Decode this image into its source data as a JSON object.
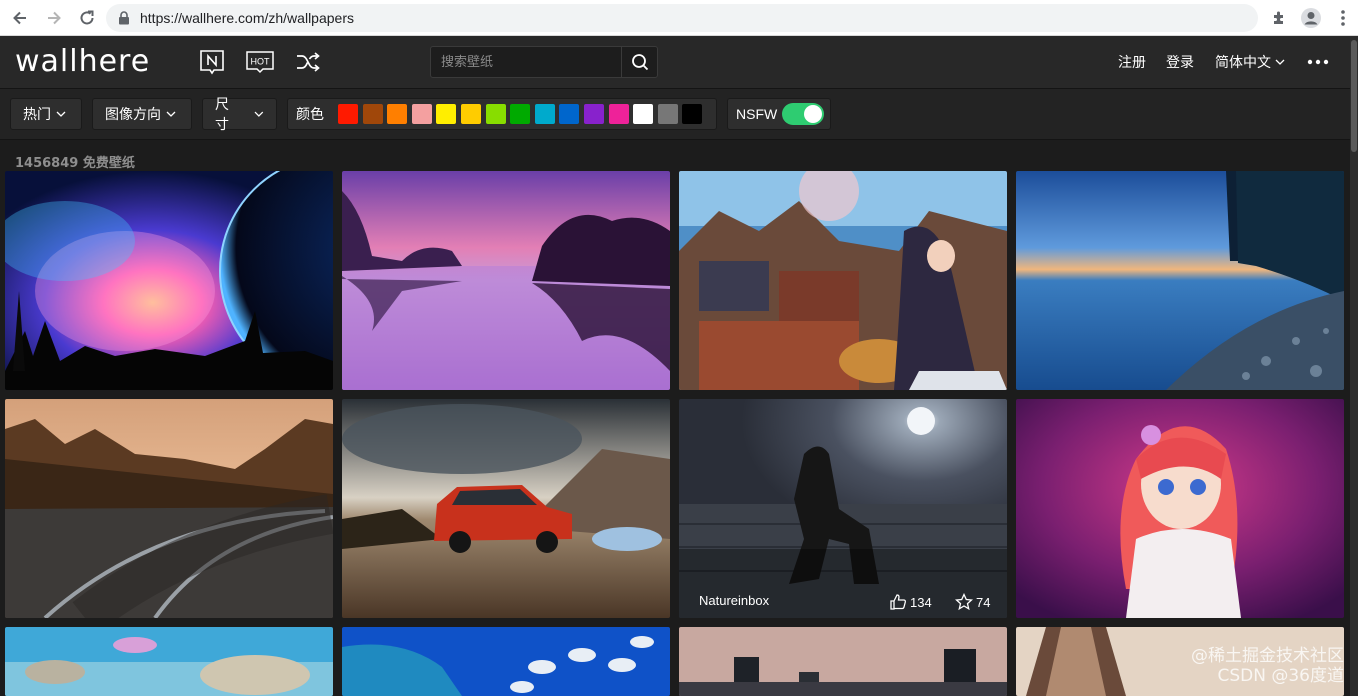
{
  "browser": {
    "url": "https://wallhere.com/zh/wallpapers",
    "icons": [
      "back-arrow-icon",
      "forward-arrow-icon",
      "reload-icon",
      "lock-icon",
      "extensions-icon",
      "profile-icon",
      "menu-dots-icon"
    ]
  },
  "header": {
    "logo": "wallhere",
    "search_placeholder": "搜索壁纸",
    "register": "注册",
    "login": "登录",
    "language": "简体中文",
    "icons": [
      "new-icon",
      "hot-icon",
      "shuffle-icon",
      "search-icon",
      "more-icon"
    ]
  },
  "filters": {
    "popular": "热门",
    "orientation": "图像方向",
    "size": "尺寸",
    "color_label": "颜色",
    "colors": [
      "#ff1a00",
      "#a0470a",
      "#ff7f00",
      "#f4a0a0",
      "#ffee00",
      "#ffcc00",
      "#88dd00",
      "#00aa00",
      "#00aacc",
      "#0066cc",
      "#8822cc",
      "#ee2299",
      "#ffffff",
      "#777777",
      "#000000"
    ],
    "nsfw_label": "NSFW",
    "nsfw_on": true
  },
  "count_text": "1456849 免费壁纸",
  "tiles": [
    {
      "name": "space-nebula-wallpaper"
    },
    {
      "name": "purple-lake-sunset-wallpaper"
    },
    {
      "name": "anime-town-wallpaper"
    },
    {
      "name": "blue-lake-shore-wallpaper"
    },
    {
      "name": "railway-forest-wallpaper"
    },
    {
      "name": "red-car-landscape-wallpaper"
    },
    {
      "name": "catwoman-night-wallpaper",
      "author": "Natureinbox",
      "likes": "134",
      "favorites": "74"
    },
    {
      "name": "anime-girl-pink-wallpaper"
    },
    {
      "name": "underwater-fish-wallpaper"
    },
    {
      "name": "coral-reef-fish-wallpaper"
    },
    {
      "name": "city-skyline-wallpaper"
    },
    {
      "name": "boat-wreck-wallpaper"
    }
  ],
  "watermark": {
    "line1": "@稀土掘金技术社区",
    "line2": "CSDN @36度道"
  }
}
